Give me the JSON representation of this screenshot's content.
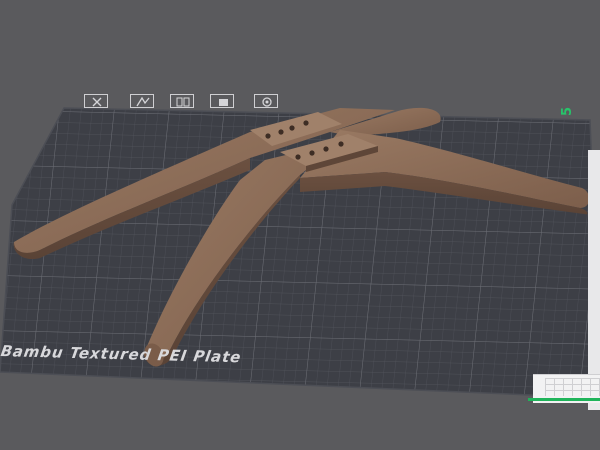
{
  "viewport": {
    "plate_label": "Bambu Textured PEI Plate",
    "plate_number": "5",
    "toolbar_icons": [
      "close-icon",
      "auto-arrange-icon",
      "orient-icon",
      "lock-icon",
      "settings-icon"
    ]
  },
  "colors": {
    "background": "#5a5a5d",
    "plate": "#3d3f46",
    "model": "#8a6a55",
    "accent_green": "#27c46a"
  }
}
